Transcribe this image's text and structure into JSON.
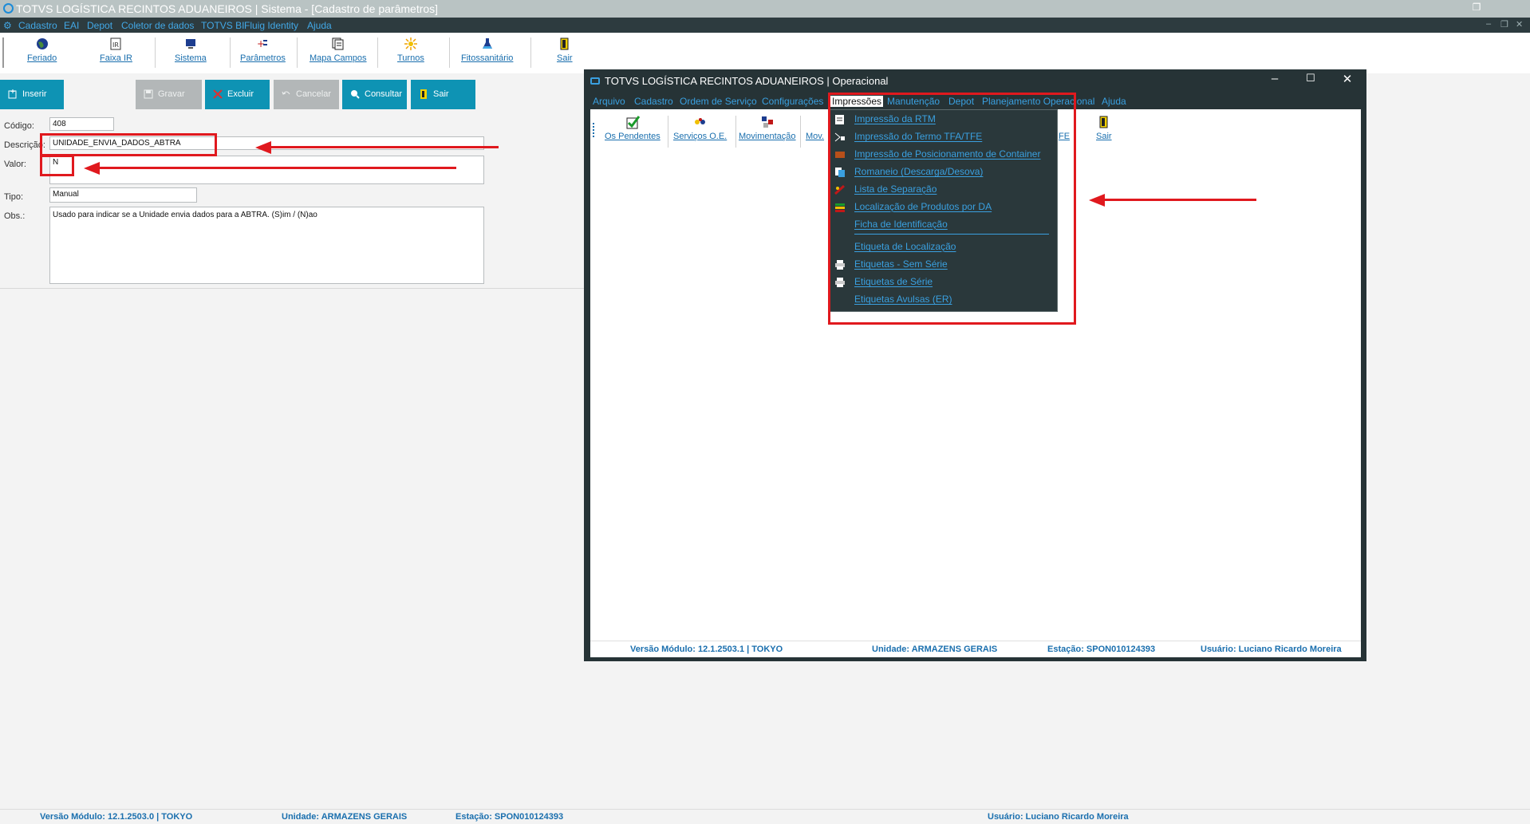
{
  "window": {
    "title": "TOTVS LOGÍSTICA RECINTOS ADUANEIROS | Sistema - [Cadastro de parâmetros]",
    "restore_glyph": "❐",
    "min_glyph": "–",
    "close_glyph": "✕"
  },
  "menu": [
    "Cadastro",
    "EAI",
    "Depot",
    "Coletor de dados",
    "TOTVS BI",
    "Fluig Identity",
    "Ajuda"
  ],
  "toolbar": [
    {
      "label": "Feriado",
      "icon": "globe-icon"
    },
    {
      "label": "Faixa IR",
      "icon": "document-icon"
    },
    {
      "label": "Sistema",
      "icon": "computer-icon"
    },
    {
      "label": "Parâmetros",
      "icon": "parameters-icon"
    },
    {
      "label": "Mapa Campos",
      "icon": "map-icon"
    },
    {
      "label": "Turnos",
      "icon": "sun-icon"
    },
    {
      "label": "Fitossanitário",
      "icon": "flask-icon"
    },
    {
      "label": "Sair",
      "icon": "exit-icon"
    }
  ],
  "actions": {
    "insert": "Inserir",
    "save": "Gravar",
    "delete": "Excluir",
    "cancel": "Cancelar",
    "query": "Consultar",
    "exit": "Sair"
  },
  "form": {
    "code_label": "Código:",
    "code_value": "408",
    "description_label": "Descrição:",
    "description_value": "UNIDADE_ENVIA_DADOS_ABTRA",
    "value_label": "Valor:",
    "value_value": "N",
    "type_label": "Tipo:",
    "type_value": "Manual",
    "obs_label": "Obs.:",
    "obs_value": "Usado para indicar se a Unidade envia dados para a ABTRA. (S)im / (N)ao"
  },
  "status": {
    "version": "Versão Módulo:   12.1.2503.0  |  TOKYO",
    "unit": "Unidade: ARMAZENS GERAIS",
    "station": "Estação: SPON010124393",
    "user": "Usuário: Luciano Ricardo Moreira"
  },
  "inner": {
    "title": "TOTVS LOGÍSTICA RECINTOS ADUANEIROS | Operacional",
    "menu": [
      "Arquivo",
      "Cadastro",
      "Ordem de Serviço",
      "Configurações",
      "Impressões",
      "Manutenção",
      "Depot",
      "Planejamento Operacional",
      "Ajuda"
    ],
    "toolbar": [
      {
        "label": "Os Pendentes",
        "icon": "checkmark-icon"
      },
      {
        "label": "Serviços O.E.",
        "icon": "services-icon"
      },
      {
        "label": "Movimentação",
        "icon": "movement-icon"
      },
      {
        "label": "Mov.",
        "icon": ""
      },
      {
        "label": "FE",
        "icon": ""
      },
      {
        "label": "Sair",
        "icon": "exit-icon"
      }
    ],
    "dropdown": [
      {
        "label": "Impressão da RTM",
        "icon": "printer-doc-icon"
      },
      {
        "label": "Impressão do Termo TFA/TFE",
        "icon": "term-icon"
      },
      {
        "label": "Impressão de Posicionamento de Container",
        "icon": "container-icon"
      },
      {
        "label": "Romaneio (Descarga/Desova)",
        "icon": "manifest-icon"
      },
      {
        "label": "Lista de Separação",
        "icon": "list-icon"
      },
      {
        "label": "Localização de Produtos por DA",
        "icon": "location-icon"
      },
      {
        "label": "Ficha de Identificação",
        "icon": ""
      },
      {
        "label": "Etiqueta de Localização",
        "icon": ""
      },
      {
        "label": "Etiquetas - Sem Série",
        "icon": "printer-icon"
      },
      {
        "label": "Etiquetas de Série",
        "icon": "printer-icon"
      },
      {
        "label": "Etiquetas Avulsas (ER)",
        "icon": ""
      }
    ],
    "status": {
      "version": "Versão Módulo:   12.1.2503.1  |  TOKYO",
      "unit": "Unidade: ARMAZENS GERAIS",
      "station": "Estação: SPON010124393",
      "user": "Usuário: Luciano Ricardo Moreira"
    }
  },
  "colors": {
    "accent": "#0e93b4",
    "link": "#1a6fae",
    "dark": "#263336",
    "annotation": "#e0191e"
  }
}
